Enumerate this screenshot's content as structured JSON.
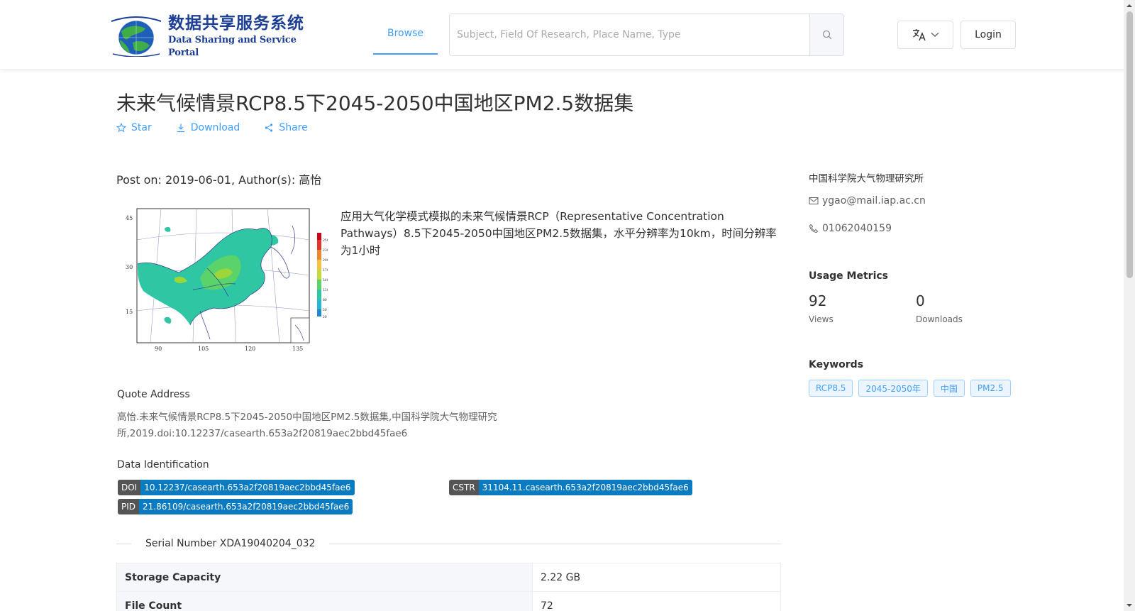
{
  "header": {
    "logo_cn": "数据共享服务系统",
    "logo_en": "Data Sharing and Service Portal",
    "nav_browse": "Browse",
    "search_placeholder": "Subject, Field Of Research, Place Name, Type",
    "login": "Login"
  },
  "dataset": {
    "title": "未来气候情景RCP8.5下2045-2050中国地区PM2.5数据集",
    "actions": {
      "star": "Star",
      "download": "Download",
      "share": "Share"
    },
    "post_info": "Post on: 2019-06-01, Author(s): 高怡",
    "description": "应用大气化学模式模拟的未来气候情景RCP（Representative Concentration Pathways）8.5下2045-2050中国地区PM2.5数据集，水平分辨率为10km，时间分辨率为1小时",
    "map_labels": {
      "y": [
        "45",
        "30",
        "15"
      ],
      "x": [
        "90",
        "105",
        "120",
        "135"
      ],
      "scale": [
        "250",
        "230",
        "200",
        "170",
        "140",
        "110",
        "80",
        "50",
        "20"
      ]
    },
    "quote_label": "Quote Address",
    "quote_text": "高怡.未来气候情景RCP8.5下2045-2050中国地区PM2.5数据集,中国科学院大气物理研究所,2019.doi:10.12237/casearth.653a2f20819aec2bbd45fae6",
    "data_identification_label": "Data Identification",
    "identifiers": {
      "doi_key": "DOI",
      "doi": "10.12237/casearth.653a2f20819aec2bbd45fae6",
      "cstr_key": "CSTR",
      "cstr": "31104.11.casearth.653a2f20819aec2bbd45fae6",
      "pid_key": "PID",
      "pid": "21.86109/casearth.653a2f20819aec2bbd45fae6"
    },
    "serial_number": "Serial Number XDA19040204_032",
    "table": [
      {
        "key": "Storage Capacity",
        "value": "2.22 GB"
      },
      {
        "key": "File Count",
        "value": "72"
      }
    ]
  },
  "sidebar": {
    "organization": "中国科学院大气物理研究所",
    "email": "ygao@mail.iap.ac.cn",
    "phone": "01062040159",
    "usage_heading": "Usage Metrics",
    "views_count": "92",
    "views_label": "Views",
    "downloads_count": "0",
    "downloads_label": "Downloads",
    "keywords_heading": "Keywords",
    "keywords": [
      "RCP8.5",
      "2045-2050年",
      "中国",
      "PM2.5"
    ]
  },
  "colors": {
    "accent": "#409eff",
    "id_value_bg": "#0a7bc1",
    "id_key_bg": "#555555",
    "logo_blue": "#1c3e94"
  }
}
